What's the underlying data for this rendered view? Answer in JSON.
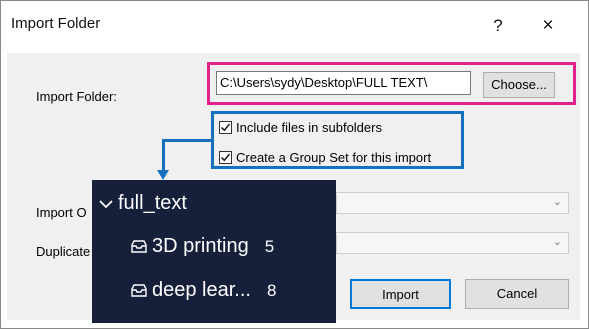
{
  "dialog": {
    "title": "Import Folder",
    "help": "?",
    "close": "×"
  },
  "form": {
    "import_folder_label": "Import Folder:",
    "folder_path": "C:\\Users\\sydy\\Desktop\\FULL TEXT\\",
    "choose_label": "Choose...",
    "include_subfolders_label": "Include files in subfolders",
    "include_subfolders_checked": true,
    "group_set_label": "Create a Group Set for this import",
    "group_set_checked": true,
    "import_options_label": "Import O",
    "duplicates_label": "Duplicate",
    "import_button": "Import",
    "cancel_button": "Cancel"
  },
  "popup": {
    "folder_name": "full_text",
    "items": [
      {
        "label": "3D printing",
        "count": "5"
      },
      {
        "label": "deep lear...",
        "count": "8"
      }
    ]
  },
  "colors": {
    "highlight_magenta": "#e21f8a",
    "highlight_blue": "#1570c0",
    "popup_bg": "#16203a"
  }
}
